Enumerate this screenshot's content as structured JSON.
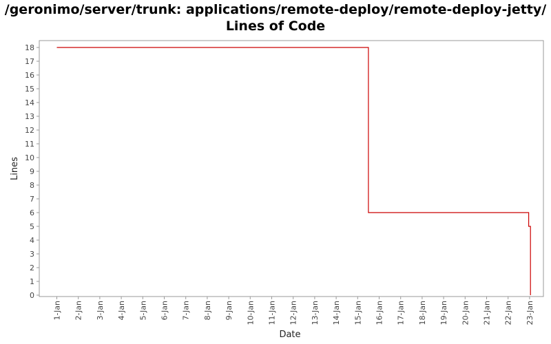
{
  "chart_data": {
    "type": "line",
    "title_line1": "/geronimo/server/trunk: applications/remote-deploy/remote-deploy-jetty/",
    "title_line2": "Lines of Code",
    "xlabel": "Date",
    "ylabel": "Lines",
    "x_ticks": [
      "1-Jan",
      "2-Jan",
      "3-Jan",
      "4-Jan",
      "5-Jan",
      "6-Jan",
      "7-Jan",
      "8-Jan",
      "9-Jan",
      "10-Jan",
      "11-Jan",
      "12-Jan",
      "13-Jan",
      "14-Jan",
      "15-Jan",
      "16-Jan",
      "17-Jan",
      "18-Jan",
      "19-Jan",
      "20-Jan",
      "21-Jan",
      "22-Jan",
      "23-Jan"
    ],
    "y_ticks": [
      0,
      1,
      2,
      3,
      4,
      5,
      6,
      7,
      8,
      9,
      10,
      11,
      12,
      13,
      14,
      15,
      16,
      17,
      18
    ],
    "ylim": [
      0,
      18.5
    ],
    "grid": false,
    "step": true,
    "line_color": "#cc0000",
    "series": [
      {
        "points": [
          {
            "x": "1-Jan 00:00",
            "y": 18
          },
          {
            "x": "15-Jan 12:00",
            "y": 18
          },
          {
            "x": "15-Jan 12:00",
            "y": 6
          },
          {
            "x": "22-Jan 23:00",
            "y": 6
          },
          {
            "x": "22-Jan 23:00",
            "y": 5
          },
          {
            "x": "23-Jan 01:00",
            "y": 5
          },
          {
            "x": "23-Jan 01:00",
            "y": 0
          }
        ]
      }
    ]
  }
}
